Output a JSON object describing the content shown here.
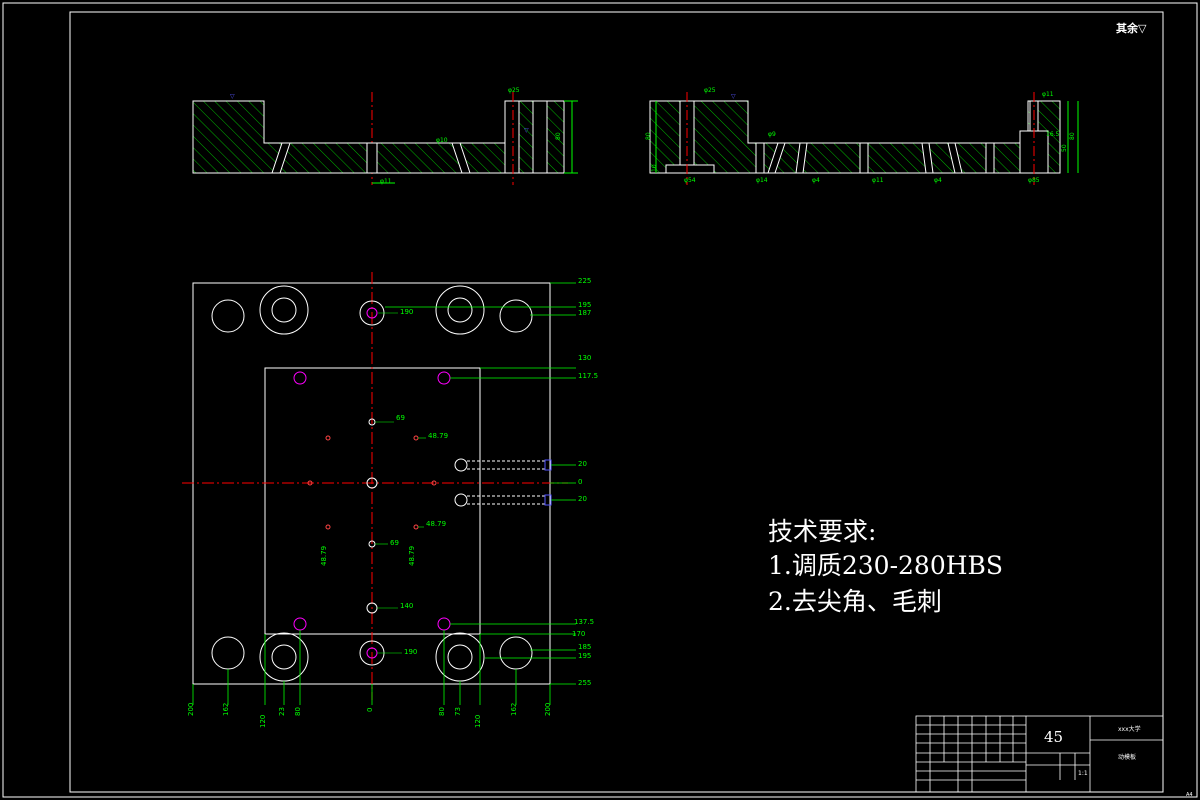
{
  "title_block": {
    "material": "45",
    "school": "xxx大学",
    "part_name": "动模板",
    "scale": "1:1",
    "roughness_note": "其余▽"
  },
  "tech_requirements": {
    "title": "技术要求:",
    "items": [
      "1.调质230-280HBS",
      "2.去尖角、毛刺"
    ]
  },
  "dimensions": {
    "top_right": [
      "225",
      "195",
      "187",
      "130",
      "117.5",
      "20",
      "0",
      "20",
      "137.5",
      "170",
      "185",
      "195",
      "255"
    ],
    "bottom": [
      "200",
      "162",
      "120",
      "23",
      "80",
      "0",
      "80",
      "73",
      "120",
      "162",
      "200"
    ],
    "inner": [
      "190",
      "69",
      "48.79",
      "48.79",
      "69",
      "48.79",
      "140",
      "190",
      "48.79"
    ],
    "section_left": [
      "φ25",
      "φ10",
      "φ11",
      "80",
      "13"
    ],
    "section_right": [
      "φ25",
      "φ11",
      "φ9",
      "φ14",
      "φ54",
      "φ4",
      "φ11",
      "φ4",
      "φ85",
      "16.5",
      "80",
      "50",
      "80",
      "10"
    ]
  },
  "sheet_corner": "A4"
}
